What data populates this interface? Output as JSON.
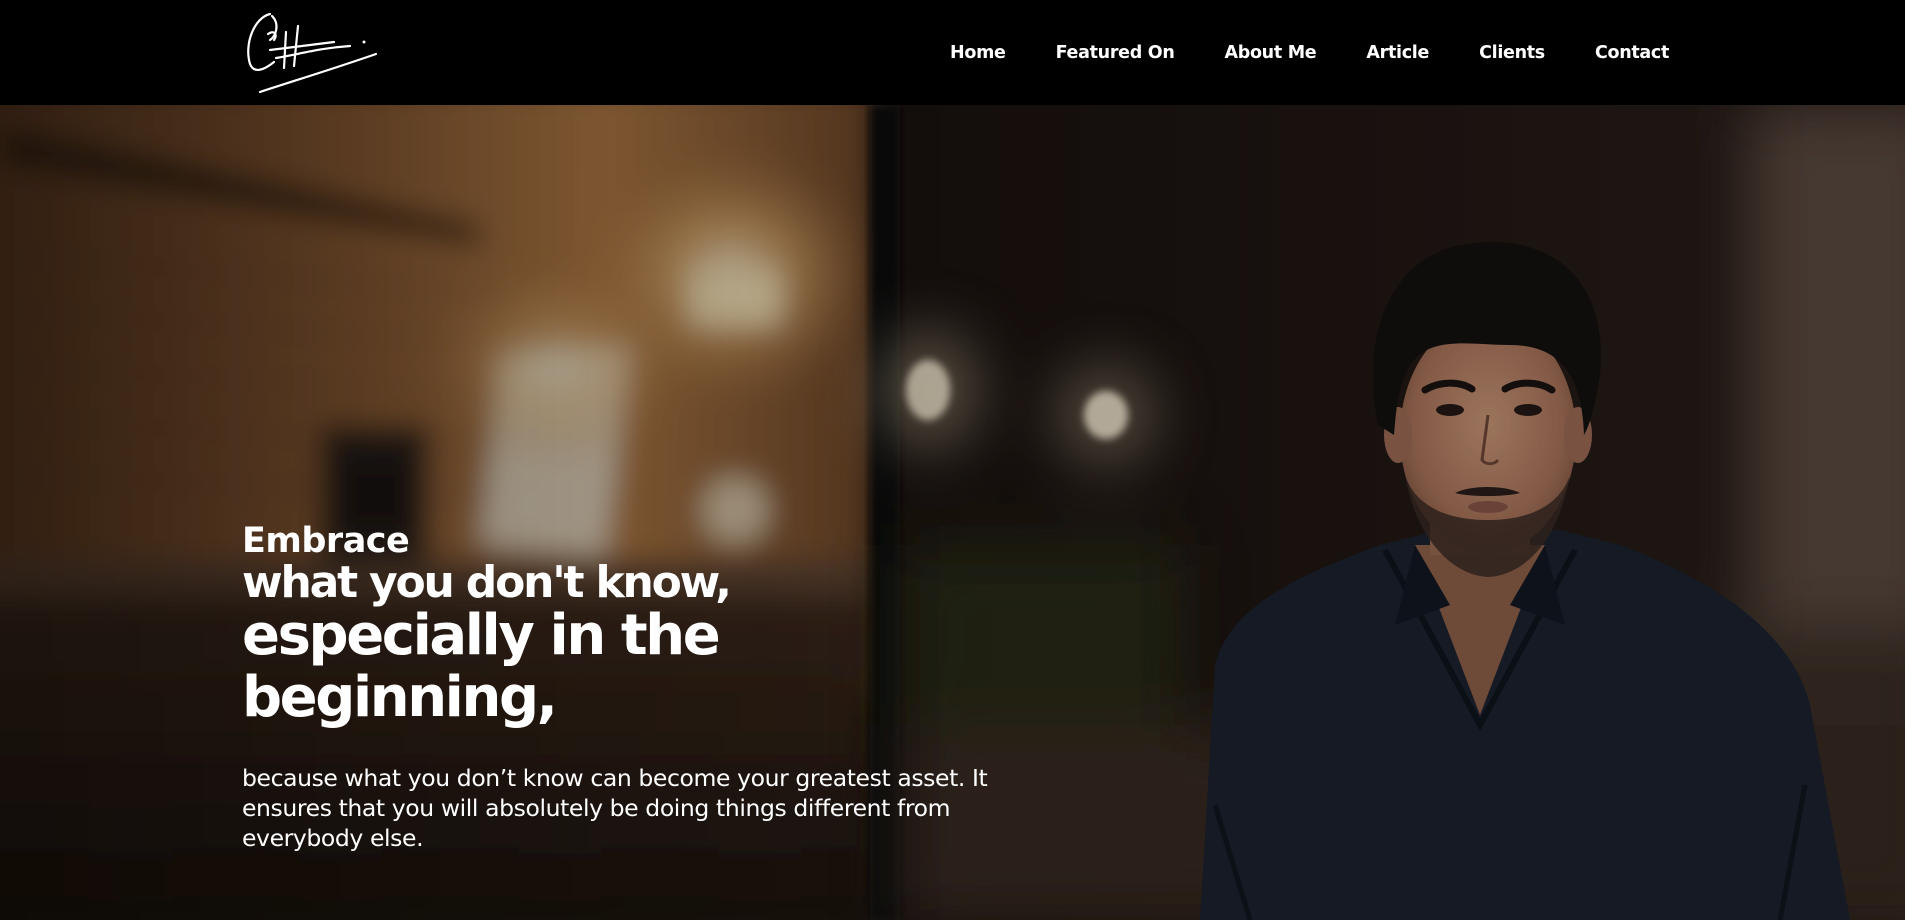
{
  "header": {
    "logo_name": "signature-logo",
    "nav": [
      {
        "label": "Home"
      },
      {
        "label": "Featured On"
      },
      {
        "label": "About Me"
      },
      {
        "label": "Article"
      },
      {
        "label": "Clients"
      },
      {
        "label": "Contact"
      }
    ]
  },
  "hero": {
    "line1": "Embrace",
    "line2": "what you don't know,",
    "line3": "especially in the beginning,",
    "body": "because what you don’t know can become your greatest asset. It ensures that you will absolutely be doing things different from everybody else."
  },
  "colors": {
    "header_bg": "#000000",
    "text": "#ffffff",
    "warm_light": "#d79a55",
    "shirt": "#1b2230"
  }
}
